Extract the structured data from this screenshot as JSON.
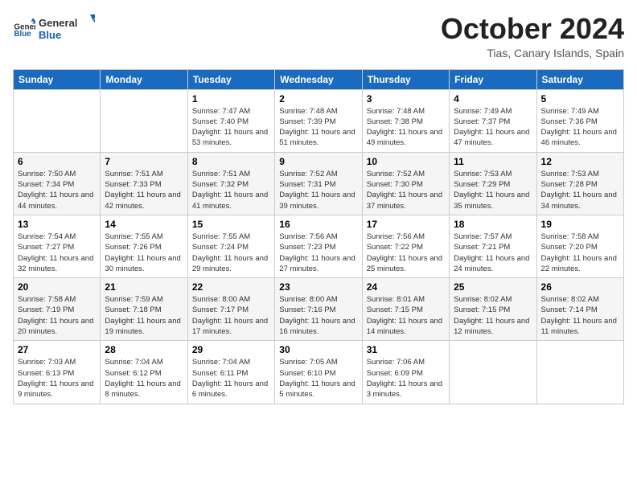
{
  "header": {
    "logo": {
      "general": "General",
      "blue": "Blue"
    },
    "title": "October 2024",
    "subtitle": "Tias, Canary Islands, Spain"
  },
  "calendar": {
    "days_of_week": [
      "Sunday",
      "Monday",
      "Tuesday",
      "Wednesday",
      "Thursday",
      "Friday",
      "Saturday"
    ],
    "weeks": [
      [
        {
          "day": "",
          "info": ""
        },
        {
          "day": "",
          "info": ""
        },
        {
          "day": "1",
          "info": "Sunrise: 7:47 AM\nSunset: 7:40 PM\nDaylight: 11 hours and 53 minutes."
        },
        {
          "day": "2",
          "info": "Sunrise: 7:48 AM\nSunset: 7:39 PM\nDaylight: 11 hours and 51 minutes."
        },
        {
          "day": "3",
          "info": "Sunrise: 7:48 AM\nSunset: 7:38 PM\nDaylight: 11 hours and 49 minutes."
        },
        {
          "day": "4",
          "info": "Sunrise: 7:49 AM\nSunset: 7:37 PM\nDaylight: 11 hours and 47 minutes."
        },
        {
          "day": "5",
          "info": "Sunrise: 7:49 AM\nSunset: 7:36 PM\nDaylight: 11 hours and 46 minutes."
        }
      ],
      [
        {
          "day": "6",
          "info": "Sunrise: 7:50 AM\nSunset: 7:34 PM\nDaylight: 11 hours and 44 minutes."
        },
        {
          "day": "7",
          "info": "Sunrise: 7:51 AM\nSunset: 7:33 PM\nDaylight: 11 hours and 42 minutes."
        },
        {
          "day": "8",
          "info": "Sunrise: 7:51 AM\nSunset: 7:32 PM\nDaylight: 11 hours and 41 minutes."
        },
        {
          "day": "9",
          "info": "Sunrise: 7:52 AM\nSunset: 7:31 PM\nDaylight: 11 hours and 39 minutes."
        },
        {
          "day": "10",
          "info": "Sunrise: 7:52 AM\nSunset: 7:30 PM\nDaylight: 11 hours and 37 minutes."
        },
        {
          "day": "11",
          "info": "Sunrise: 7:53 AM\nSunset: 7:29 PM\nDaylight: 11 hours and 35 minutes."
        },
        {
          "day": "12",
          "info": "Sunrise: 7:53 AM\nSunset: 7:28 PM\nDaylight: 11 hours and 34 minutes."
        }
      ],
      [
        {
          "day": "13",
          "info": "Sunrise: 7:54 AM\nSunset: 7:27 PM\nDaylight: 11 hours and 32 minutes."
        },
        {
          "day": "14",
          "info": "Sunrise: 7:55 AM\nSunset: 7:26 PM\nDaylight: 11 hours and 30 minutes."
        },
        {
          "day": "15",
          "info": "Sunrise: 7:55 AM\nSunset: 7:24 PM\nDaylight: 11 hours and 29 minutes."
        },
        {
          "day": "16",
          "info": "Sunrise: 7:56 AM\nSunset: 7:23 PM\nDaylight: 11 hours and 27 minutes."
        },
        {
          "day": "17",
          "info": "Sunrise: 7:56 AM\nSunset: 7:22 PM\nDaylight: 11 hours and 25 minutes."
        },
        {
          "day": "18",
          "info": "Sunrise: 7:57 AM\nSunset: 7:21 PM\nDaylight: 11 hours and 24 minutes."
        },
        {
          "day": "19",
          "info": "Sunrise: 7:58 AM\nSunset: 7:20 PM\nDaylight: 11 hours and 22 minutes."
        }
      ],
      [
        {
          "day": "20",
          "info": "Sunrise: 7:58 AM\nSunset: 7:19 PM\nDaylight: 11 hours and 20 minutes."
        },
        {
          "day": "21",
          "info": "Sunrise: 7:59 AM\nSunset: 7:18 PM\nDaylight: 11 hours and 19 minutes."
        },
        {
          "day": "22",
          "info": "Sunrise: 8:00 AM\nSunset: 7:17 PM\nDaylight: 11 hours and 17 minutes."
        },
        {
          "day": "23",
          "info": "Sunrise: 8:00 AM\nSunset: 7:16 PM\nDaylight: 11 hours and 16 minutes."
        },
        {
          "day": "24",
          "info": "Sunrise: 8:01 AM\nSunset: 7:15 PM\nDaylight: 11 hours and 14 minutes."
        },
        {
          "day": "25",
          "info": "Sunrise: 8:02 AM\nSunset: 7:15 PM\nDaylight: 11 hours and 12 minutes."
        },
        {
          "day": "26",
          "info": "Sunrise: 8:02 AM\nSunset: 7:14 PM\nDaylight: 11 hours and 11 minutes."
        }
      ],
      [
        {
          "day": "27",
          "info": "Sunrise: 7:03 AM\nSunset: 6:13 PM\nDaylight: 11 hours and 9 minutes."
        },
        {
          "day": "28",
          "info": "Sunrise: 7:04 AM\nSunset: 6:12 PM\nDaylight: 11 hours and 8 minutes."
        },
        {
          "day": "29",
          "info": "Sunrise: 7:04 AM\nSunset: 6:11 PM\nDaylight: 11 hours and 6 minutes."
        },
        {
          "day": "30",
          "info": "Sunrise: 7:05 AM\nSunset: 6:10 PM\nDaylight: 11 hours and 5 minutes."
        },
        {
          "day": "31",
          "info": "Sunrise: 7:06 AM\nSunset: 6:09 PM\nDaylight: 11 hours and 3 minutes."
        },
        {
          "day": "",
          "info": ""
        },
        {
          "day": "",
          "info": ""
        }
      ]
    ]
  }
}
